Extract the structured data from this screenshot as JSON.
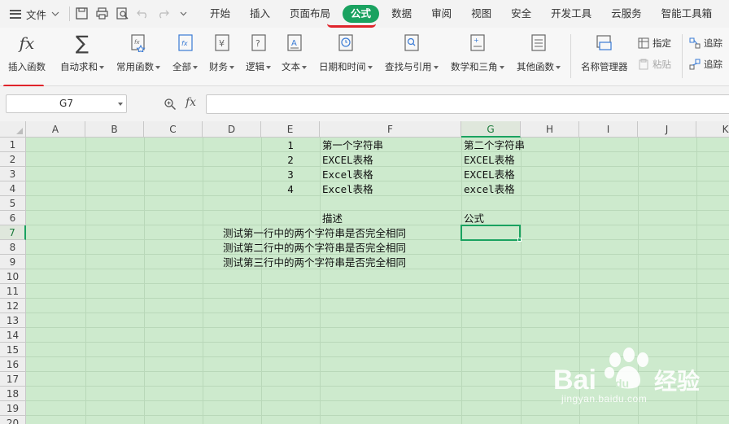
{
  "menubar": {
    "file_label": "文件",
    "tabs": [
      "开始",
      "插入",
      "页面布局",
      "公式",
      "数据",
      "审阅",
      "视图",
      "安全",
      "开发工具",
      "云服务",
      "智能工具箱"
    ],
    "active_tab": "公式",
    "accent_color": "#1aa260",
    "mark_color": "#e0242b"
  },
  "ribbon": {
    "insert_function": "插入函数",
    "autosum": "自动求和",
    "common_functions": "常用函数",
    "all": "全部",
    "financial": "财务",
    "logical": "逻辑",
    "text": "文本",
    "datetime": "日期和时间",
    "lookup": "查找与引用",
    "math": "数学和三角",
    "other": "其他函数",
    "name_manager": "名称管理器",
    "specify": "指定",
    "paste": "粘贴",
    "trace1": "追踪",
    "trace2": "追踪"
  },
  "formulabar": {
    "namebox_value": "G7",
    "fx_label": "fx",
    "formula_value": ""
  },
  "sheet": {
    "columns": [
      "A",
      "B",
      "C",
      "D",
      "E",
      "F",
      "G",
      "H",
      "I",
      "J",
      "K"
    ],
    "rows": [
      "1",
      "2",
      "3",
      "4",
      "5",
      "6",
      "7",
      "8",
      "9",
      "10",
      "11",
      "12",
      "13",
      "14",
      "15",
      "16",
      "17",
      "18",
      "19",
      "20"
    ],
    "selected_column": "G",
    "selected_row": "7",
    "cells": {
      "E1": "1",
      "E2": "2",
      "E3": "3",
      "E4": "4",
      "F1": "第一个字符串",
      "F2": "EXCEL表格",
      "F3": "Excel表格",
      "F4": "Excel表格",
      "G1": "第二个字符串",
      "G2": "EXCEL表格",
      "G3": "EXCEL表格",
      "G4": "excel表格",
      "F6": "描述",
      "G6": "公式",
      "D7": "测试第一行中的两个字符串是否完全相同",
      "D8": "测试第二行中的两个字符串是否完全相同",
      "D9": "测试第三行中的两个字符串是否完全相同"
    },
    "grid_color": "#cdeacd"
  },
  "watermark": {
    "brand": "Bai",
    "brand2": "du",
    "brand_cn": "经验",
    "url": "jingyan.baidu.com"
  }
}
